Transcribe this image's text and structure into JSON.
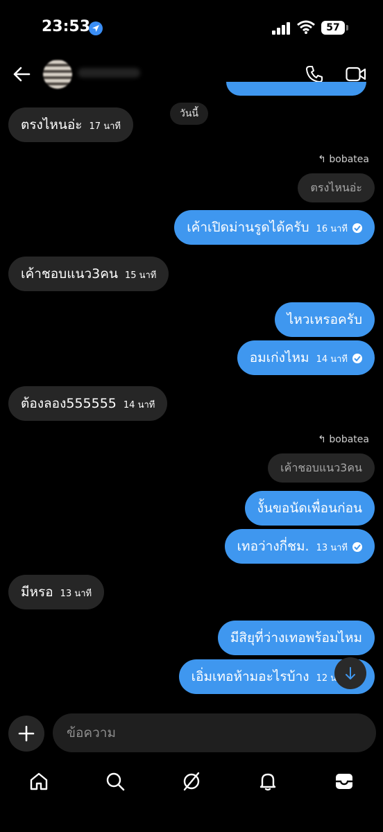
{
  "status_bar": {
    "time": "23:53",
    "battery": "57",
    "icons": [
      "location-icon",
      "signal-icon",
      "wifi-icon",
      "battery-icon"
    ]
  },
  "header": {
    "icons": [
      "back-arrow-icon",
      "phone-icon",
      "video-icon"
    ]
  },
  "date_separator": "วันนี้",
  "messages": [
    {
      "text": "ตรงไหนอ่ะ",
      "time": "17 นาที"
    },
    {
      "reply_to": "bobatea",
      "quoted": "ตรงไหนอ่ะ"
    },
    {
      "text": "เค้าเปิดม่านรูดได้ครับ",
      "time": "16 นาที"
    },
    {
      "text": "เค้าชอบแนว3คน",
      "time": "15 นาที"
    },
    {
      "text": "ไหวเหรอครับ"
    },
    {
      "text": "อมเก่งไหม",
      "time": "14 นาที"
    },
    {
      "text": "ต้องลอง555555",
      "time": "14 นาที"
    },
    {
      "reply_to": "bobatea",
      "quoted": "เค้าชอบแนว3คน"
    },
    {
      "text": "งั้นขอนัดเพื่อนก่อน"
    },
    {
      "text": "เทอว่างกี่ชม.",
      "time": "13 นาที"
    },
    {
      "text": "มีหรอ",
      "time": "13 นาที"
    },
    {
      "text": "มีสิยุที่ว่างเทอพร้อมไหม"
    },
    {
      "text": "เอิ่มเทอห้ามอะไรบ้าง",
      "time": "12 นาที"
    }
  ],
  "composer": {
    "placeholder": "ข้อความ"
  },
  "tab_bar": [
    "home-icon",
    "search-icon",
    "explore-icon",
    "notifications-icon",
    "inbox-icon"
  ]
}
